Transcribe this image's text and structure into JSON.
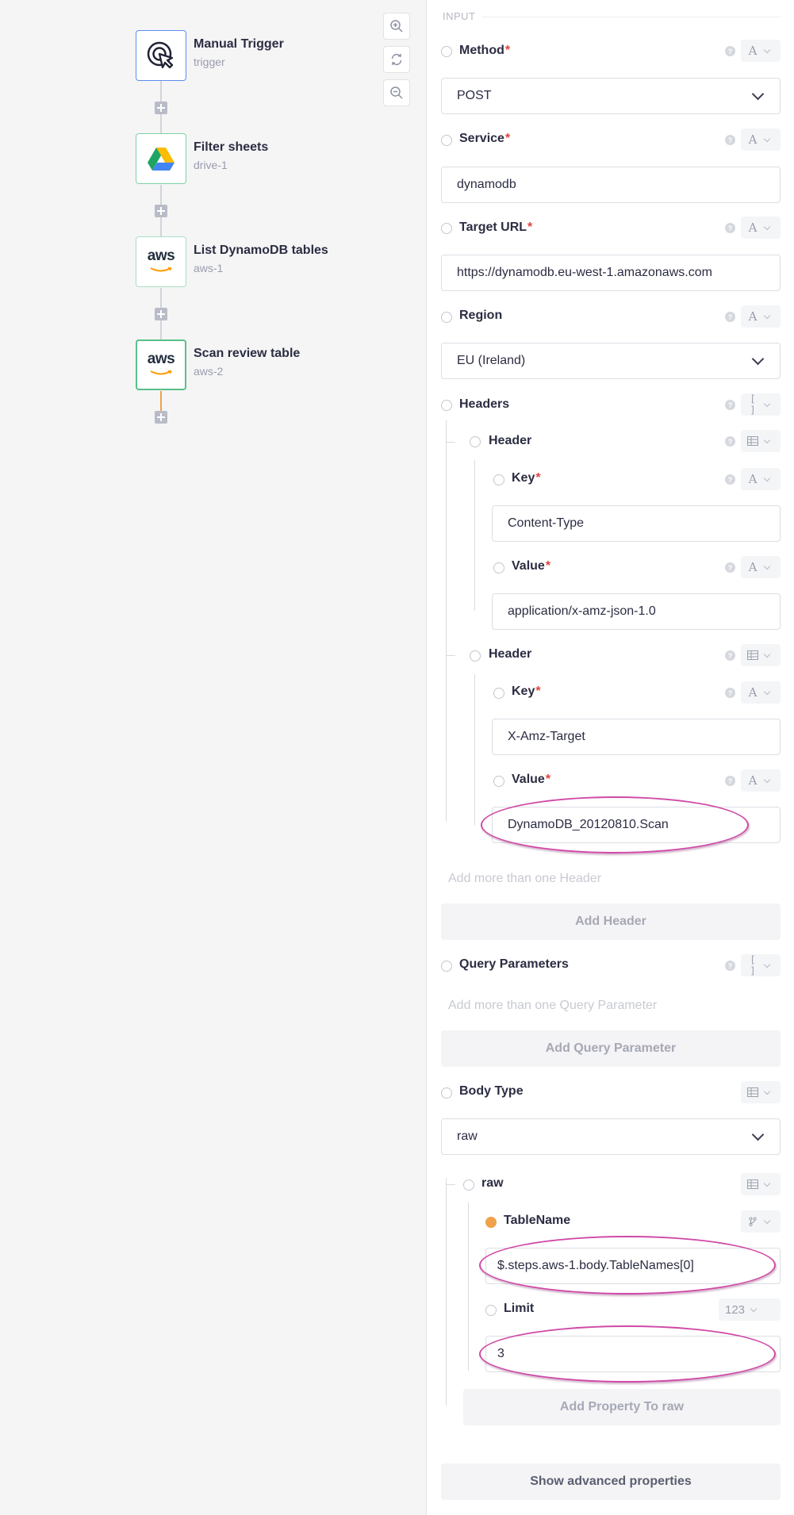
{
  "canvas": {
    "nodes": [
      {
        "title": "Manual Trigger",
        "subtitle": "trigger",
        "icon": "cursor-click-icon"
      },
      {
        "title": "Filter sheets",
        "subtitle": "drive-1",
        "icon": "google-drive-icon"
      },
      {
        "title": "List DynamoDB tables",
        "subtitle": "aws-1",
        "icon": "aws-icon"
      },
      {
        "title": "Scan review table",
        "subtitle": "aws-2",
        "icon": "aws-icon"
      }
    ],
    "aws_logo_text": "aws",
    "zoom_controls": [
      "zoom-in-icon",
      "refresh-icon",
      "zoom-out-icon"
    ]
  },
  "panel": {
    "section": "INPUT",
    "required_mark": "*",
    "method": {
      "label": "Method",
      "value": "POST",
      "type": "A"
    },
    "service": {
      "label": "Service",
      "value": "dynamodb",
      "type": "A"
    },
    "target_url": {
      "label": "Target URL",
      "value": "https://dynamodb.eu-west-1.amazonaws.com",
      "type": "A"
    },
    "region": {
      "label": "Region",
      "value": "EU (Ireland)",
      "type": "A"
    },
    "headers": {
      "label": "Headers",
      "type": "[ ]",
      "items": [
        {
          "label": "Header",
          "key_label": "Key",
          "key": "Content-Type",
          "value_label": "Value",
          "value": "application/x-amz-json-1.0"
        },
        {
          "label": "Header",
          "key_label": "Key",
          "key": "X-Amz-Target",
          "value_label": "Value",
          "value": "DynamoDB_20120810.Scan"
        }
      ],
      "hint": "Add more than one Header",
      "add_label": "Add Header"
    },
    "query": {
      "label": "Query Parameters",
      "type": "[ ]",
      "hint": "Add more than one Query Parameter",
      "add_label": "Add Query Parameter"
    },
    "body_type": {
      "label": "Body Type",
      "value": "raw",
      "raw_label": "raw",
      "table_name": {
        "label": "TableName",
        "value": "$.steps.aws-1.body.TableNames[0]"
      },
      "limit": {
        "label": "Limit",
        "type": "123",
        "value": "3"
      },
      "add_label": "Add Property To raw"
    },
    "advanced_label": "Show advanced properties",
    "help_glyph": "?",
    "colors": {
      "accent_orange": "#f0a14a",
      "highlight_oval": "#d04aa7",
      "required": "#e0443d",
      "trigger_border": "#5b8def",
      "node_border_green": "#7fd1a4"
    }
  }
}
